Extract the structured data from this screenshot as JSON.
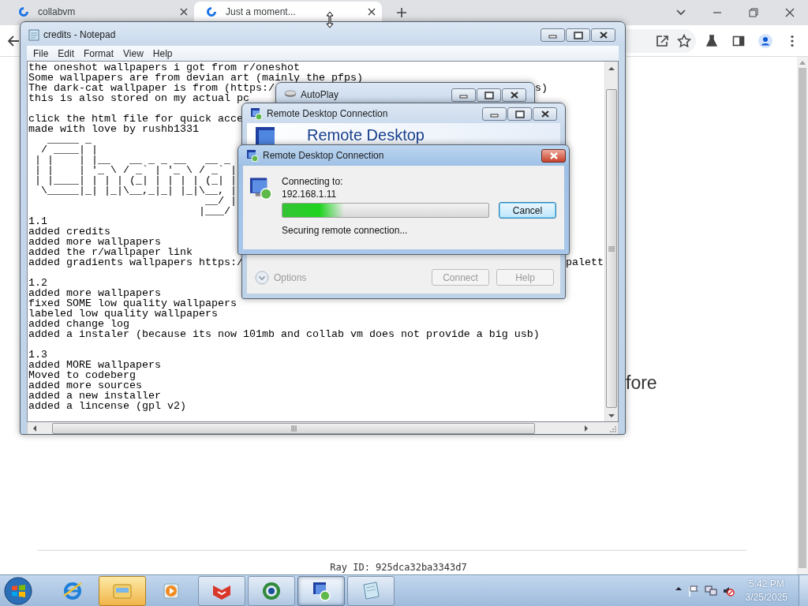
{
  "browser": {
    "tabs": [
      {
        "title": "collabvm",
        "selected": false
      },
      {
        "title": "Just a moment...",
        "selected": true
      }
    ]
  },
  "page": {
    "heading_fragment": "fore",
    "ray_id": "Ray ID: 925dca32ba3343d7"
  },
  "notepad": {
    "title": "credits - Notepad",
    "menu": [
      "File",
      "Edit",
      "Format",
      "View",
      "Help"
    ],
    "paragraphs": [
      [
        {
          "text": "the oneshot wallpapers i got from r/oneshot"
        },
        {
          "text": "Some wallpapers are from devian art (mainly the pfps)"
        },
        {
          "text": "The dark-cat wallpaper is from (https:/",
          "tail": "s)"
        },
        {
          "text": "this is also stored on my actual pc"
        }
      ],
      [
        {
          "text": "click the html file for quick acce"
        },
        {
          "text": "made with love by rushb1331"
        },
        {
          "text": "   _____ _"
        },
        {
          "text": "  / ____| |"
        },
        {
          "text": " | |    | |__   __ _ _ __   __ _"
        },
        {
          "text": " | |    | '_ \\ / _` | '_ \\ / _` |"
        },
        {
          "text": " | |____| | | | (_| | | | | (_| |"
        },
        {
          "text": "  \\_____|_| |_|\\__,_|_| |_|\\__, |"
        },
        {
          "text": "                            __/ |"
        },
        {
          "text": "                           |___/"
        },
        {
          "text": "1.1"
        },
        {
          "text": "added credits"
        },
        {
          "text": "added more wallpapers"
        },
        {
          "text": "added the r/wallpaper link"
        },
        {
          "text": "added gradients wallpapers https:/",
          "tail": "palett"
        }
      ],
      [
        {
          "text": "1.2"
        },
        {
          "text": "added more wallpapers"
        },
        {
          "text": "fixed SOME low quality wallpapers"
        },
        {
          "text": "labeled low quality wallpapers"
        },
        {
          "text": "added change log"
        },
        {
          "text": "added a instaler (because its now 101mb and collab vm does not provide a big usb)"
        }
      ],
      [
        {
          "text": "1.3"
        },
        {
          "text": "added MORE wallpapers"
        },
        {
          "text": "Moved to codeberg"
        },
        {
          "text": "added more sources"
        },
        {
          "text": "added a new installer"
        },
        {
          "text": "added a lincense (gpl v2)"
        }
      ]
    ]
  },
  "autoplay": {
    "title": "AutoPlay"
  },
  "rdc_window": {
    "title": "Remote Desktop Connection",
    "banner": "Remote Desktop",
    "options": {
      "label": "Options",
      "disabled": true
    },
    "buttons": [
      {
        "label": "Connect",
        "disabled": true
      },
      {
        "label": "Help",
        "disabled": true
      }
    ]
  },
  "rdc_dialog": {
    "title": "Remote Desktop Connection",
    "label": "Connecting to:",
    "host": "192.168.1.11",
    "progress": {
      "level": 0.3
    },
    "status": "Securing remote connection...",
    "button": {
      "label": "Cancel",
      "disabled": false
    }
  },
  "taskbar": {
    "items": [
      {
        "kind": "ie",
        "running": false,
        "selected": false,
        "flashing": false
      },
      {
        "kind": "explorer",
        "running": true,
        "selected": false,
        "flashing": true
      },
      {
        "kind": "media",
        "running": false,
        "selected": false,
        "flashing": false
      },
      {
        "kind": "fox",
        "running": true,
        "selected": false,
        "flashing": false
      },
      {
        "kind": "globe",
        "running": true,
        "selected": false,
        "flashing": false
      },
      {
        "kind": "rdc",
        "running": true,
        "selected": true,
        "flashing": false
      },
      {
        "kind": "notepad",
        "running": true,
        "selected": false,
        "flashing": false
      }
    ],
    "clock": {
      "time": "5:42 PM",
      "date": "3/25/2025"
    }
  }
}
